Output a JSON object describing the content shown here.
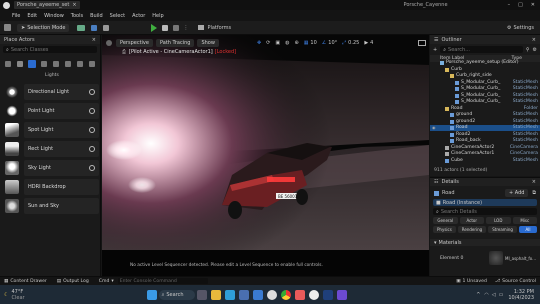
{
  "window": {
    "project_tab": "Porsche_ayeeme_set",
    "window_title": "Porsche_Cayenne"
  },
  "menu": [
    "File",
    "Edit",
    "Window",
    "Tools",
    "Build",
    "Select",
    "Actor",
    "Help"
  ],
  "toolbar": {
    "mode": "Selection Mode",
    "platforms": "Platforms",
    "settings": "Settings"
  },
  "left_panel": {
    "title": "Place Actors",
    "search_placeholder": "Search Classes",
    "section_label": "Lights",
    "items": [
      {
        "label": "Directional Light",
        "icon": "sun-icon"
      },
      {
        "label": "Point Light",
        "icon": "bulb-icon"
      },
      {
        "label": "Spot Light",
        "icon": "spotlight-icon"
      },
      {
        "label": "Rect Light",
        "icon": "rect-light-icon"
      },
      {
        "label": "Sky Light",
        "icon": "skylight-icon"
      },
      {
        "label": "HDRI Backdrop",
        "icon": "hdri-icon"
      },
      {
        "label": "Sun and Sky",
        "icon": "sun-sky-icon"
      }
    ]
  },
  "viewport": {
    "perspective": "Perspective",
    "path_tracing": "Path Tracing",
    "show": "Show",
    "pilot_label": "[Pilot Active - CineCameraActor1]",
    "pilot_tag": "[Locked]",
    "grid_value": "10",
    "angle_value": "10°",
    "scale_value": "0.25",
    "camera_speed": "4",
    "sequencer_msg": "No active Level Sequencer detected. Please edit a Level Sequence to enable full controls.",
    "plate": "BE 56001"
  },
  "outliner": {
    "title": "Outliner",
    "search_placeholder": "Search...",
    "col_label": "Item Label",
    "col_type": "Type",
    "rows": [
      {
        "label": "Porsche_ayeeme_setup (Editor)",
        "type": "",
        "indent": 0,
        "icon": "world-icon",
        "sel": false
      },
      {
        "label": "Curb",
        "type": "",
        "indent": 1,
        "icon": "folder-icon",
        "sel": false
      },
      {
        "label": "Curb_right_side",
        "type": "",
        "indent": 2,
        "icon": "folder-icon",
        "sel": false
      },
      {
        "label": "S_Modular_Curb_",
        "type": "StaticMesh",
        "indent": 3,
        "icon": "mesh-icon",
        "sel": false
      },
      {
        "label": "S_Modular_Curb_",
        "type": "StaticMesh",
        "indent": 3,
        "icon": "mesh-icon",
        "sel": false
      },
      {
        "label": "S_Modular_Curb_",
        "type": "StaticMesh",
        "indent": 3,
        "icon": "mesh-icon",
        "sel": false
      },
      {
        "label": "S_Modular_Curb_",
        "type": "StaticMesh",
        "indent": 3,
        "icon": "mesh-icon",
        "sel": false
      },
      {
        "label": "Road",
        "type": "Folder",
        "indent": 1,
        "icon": "folder-icon",
        "sel": false
      },
      {
        "label": "ground",
        "type": "StaticMesh",
        "indent": 2,
        "icon": "mesh-icon",
        "sel": false
      },
      {
        "label": "ground2",
        "type": "StaticMesh",
        "indent": 2,
        "icon": "mesh-icon",
        "sel": false
      },
      {
        "label": "Road",
        "type": "StaticMesh",
        "indent": 2,
        "icon": "mesh-icon",
        "sel": true
      },
      {
        "label": "Road2",
        "type": "StaticMesh",
        "indent": 2,
        "icon": "mesh-icon",
        "sel": false
      },
      {
        "label": "Road_back",
        "type": "StaticMesh",
        "indent": 2,
        "icon": "mesh-icon",
        "sel": false
      },
      {
        "label": "CineCameraActor2",
        "type": "CineCamera",
        "indent": 1,
        "icon": "camera-icon",
        "sel": false
      },
      {
        "label": "CineCameraActor1",
        "type": "CineCamera",
        "indent": 1,
        "icon": "camera-icon",
        "sel": false
      },
      {
        "label": "Cube",
        "type": "StaticMesh",
        "indent": 1,
        "icon": "mesh-icon",
        "sel": false
      }
    ],
    "footer": "911 actors (1 selected)"
  },
  "details": {
    "title": "Details",
    "actor_name": "Road",
    "add_label": "+ Add",
    "instance_label": "Road (Instance)",
    "search_placeholder": "Search Details",
    "filter_row1": [
      "General",
      "Actor",
      "LOD",
      "Misc"
    ],
    "filter_row2": [
      "Physics",
      "Rendering",
      "Streaming",
      "All"
    ],
    "section": "Materials",
    "element": "Element 0",
    "material": "MI_asphalt_fo..."
  },
  "statusbar": {
    "content_drawer": "Content Drawer",
    "output_log": "Output Log",
    "cmd": "Cmd",
    "console_placeholder": "Enter Console Command",
    "unsaved": "1 Unsaved",
    "source_control": "Source Control"
  },
  "taskbar": {
    "weather_temp": "47°F",
    "weather_desc": "Clear",
    "search": "Search",
    "time": "1:32 PM",
    "date": "10/4/2023"
  },
  "colors": {
    "accent": "#2a6bd0",
    "locked": "#e03030",
    "play": "#3fae3f",
    "selection": "#1b4f8a"
  }
}
